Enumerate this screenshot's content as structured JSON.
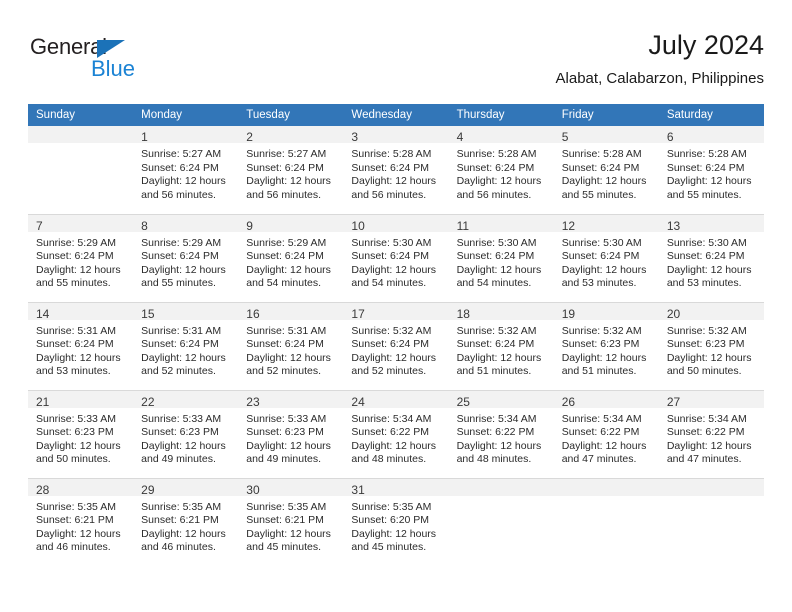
{
  "brand": {
    "name_top": "General",
    "name_bottom": "Blue",
    "triangle_color": "#1b72b8",
    "blue_text_color": "#1b83d4"
  },
  "header": {
    "title": "July 2024",
    "subtitle": "Alabat, Calabarzon, Philippines"
  },
  "theme": {
    "header_bg": "#3276b8",
    "header_text": "#ffffff",
    "daynum_bg": "#f2f2f2",
    "grid_line": "#d9d9d9",
    "body_text": "#2b2b2b"
  },
  "weekday_headers": [
    "Sunday",
    "Monday",
    "Tuesday",
    "Wednesday",
    "Thursday",
    "Friday",
    "Saturday"
  ],
  "weeks": [
    [
      {
        "day": "",
        "blank": true,
        "sunrise": "",
        "sunset": "",
        "daylight_1": "",
        "daylight_2": ""
      },
      {
        "day": "1",
        "sunrise": "Sunrise: 5:27 AM",
        "sunset": "Sunset: 6:24 PM",
        "daylight_1": "Daylight: 12 hours",
        "daylight_2": "and 56 minutes."
      },
      {
        "day": "2",
        "sunrise": "Sunrise: 5:27 AM",
        "sunset": "Sunset: 6:24 PM",
        "daylight_1": "Daylight: 12 hours",
        "daylight_2": "and 56 minutes."
      },
      {
        "day": "3",
        "sunrise": "Sunrise: 5:28 AM",
        "sunset": "Sunset: 6:24 PM",
        "daylight_1": "Daylight: 12 hours",
        "daylight_2": "and 56 minutes."
      },
      {
        "day": "4",
        "sunrise": "Sunrise: 5:28 AM",
        "sunset": "Sunset: 6:24 PM",
        "daylight_1": "Daylight: 12 hours",
        "daylight_2": "and 56 minutes."
      },
      {
        "day": "5",
        "sunrise": "Sunrise: 5:28 AM",
        "sunset": "Sunset: 6:24 PM",
        "daylight_1": "Daylight: 12 hours",
        "daylight_2": "and 55 minutes."
      },
      {
        "day": "6",
        "sunrise": "Sunrise: 5:28 AM",
        "sunset": "Sunset: 6:24 PM",
        "daylight_1": "Daylight: 12 hours",
        "daylight_2": "and 55 minutes."
      }
    ],
    [
      {
        "day": "7",
        "sunrise": "Sunrise: 5:29 AM",
        "sunset": "Sunset: 6:24 PM",
        "daylight_1": "Daylight: 12 hours",
        "daylight_2": "and 55 minutes."
      },
      {
        "day": "8",
        "sunrise": "Sunrise: 5:29 AM",
        "sunset": "Sunset: 6:24 PM",
        "daylight_1": "Daylight: 12 hours",
        "daylight_2": "and 55 minutes."
      },
      {
        "day": "9",
        "sunrise": "Sunrise: 5:29 AM",
        "sunset": "Sunset: 6:24 PM",
        "daylight_1": "Daylight: 12 hours",
        "daylight_2": "and 54 minutes."
      },
      {
        "day": "10",
        "sunrise": "Sunrise: 5:30 AM",
        "sunset": "Sunset: 6:24 PM",
        "daylight_1": "Daylight: 12 hours",
        "daylight_2": "and 54 minutes."
      },
      {
        "day": "11",
        "sunrise": "Sunrise: 5:30 AM",
        "sunset": "Sunset: 6:24 PM",
        "daylight_1": "Daylight: 12 hours",
        "daylight_2": "and 54 minutes."
      },
      {
        "day": "12",
        "sunrise": "Sunrise: 5:30 AM",
        "sunset": "Sunset: 6:24 PM",
        "daylight_1": "Daylight: 12 hours",
        "daylight_2": "and 53 minutes."
      },
      {
        "day": "13",
        "sunrise": "Sunrise: 5:30 AM",
        "sunset": "Sunset: 6:24 PM",
        "daylight_1": "Daylight: 12 hours",
        "daylight_2": "and 53 minutes."
      }
    ],
    [
      {
        "day": "14",
        "sunrise": "Sunrise: 5:31 AM",
        "sunset": "Sunset: 6:24 PM",
        "daylight_1": "Daylight: 12 hours",
        "daylight_2": "and 53 minutes."
      },
      {
        "day": "15",
        "sunrise": "Sunrise: 5:31 AM",
        "sunset": "Sunset: 6:24 PM",
        "daylight_1": "Daylight: 12 hours",
        "daylight_2": "and 52 minutes."
      },
      {
        "day": "16",
        "sunrise": "Sunrise: 5:31 AM",
        "sunset": "Sunset: 6:24 PM",
        "daylight_1": "Daylight: 12 hours",
        "daylight_2": "and 52 minutes."
      },
      {
        "day": "17",
        "sunrise": "Sunrise: 5:32 AM",
        "sunset": "Sunset: 6:24 PM",
        "daylight_1": "Daylight: 12 hours",
        "daylight_2": "and 52 minutes."
      },
      {
        "day": "18",
        "sunrise": "Sunrise: 5:32 AM",
        "sunset": "Sunset: 6:24 PM",
        "daylight_1": "Daylight: 12 hours",
        "daylight_2": "and 51 minutes."
      },
      {
        "day": "19",
        "sunrise": "Sunrise: 5:32 AM",
        "sunset": "Sunset: 6:23 PM",
        "daylight_1": "Daylight: 12 hours",
        "daylight_2": "and 51 minutes."
      },
      {
        "day": "20",
        "sunrise": "Sunrise: 5:32 AM",
        "sunset": "Sunset: 6:23 PM",
        "daylight_1": "Daylight: 12 hours",
        "daylight_2": "and 50 minutes."
      }
    ],
    [
      {
        "day": "21",
        "sunrise": "Sunrise: 5:33 AM",
        "sunset": "Sunset: 6:23 PM",
        "daylight_1": "Daylight: 12 hours",
        "daylight_2": "and 50 minutes."
      },
      {
        "day": "22",
        "sunrise": "Sunrise: 5:33 AM",
        "sunset": "Sunset: 6:23 PM",
        "daylight_1": "Daylight: 12 hours",
        "daylight_2": "and 49 minutes."
      },
      {
        "day": "23",
        "sunrise": "Sunrise: 5:33 AM",
        "sunset": "Sunset: 6:23 PM",
        "daylight_1": "Daylight: 12 hours",
        "daylight_2": "and 49 minutes."
      },
      {
        "day": "24",
        "sunrise": "Sunrise: 5:34 AM",
        "sunset": "Sunset: 6:22 PM",
        "daylight_1": "Daylight: 12 hours",
        "daylight_2": "and 48 minutes."
      },
      {
        "day": "25",
        "sunrise": "Sunrise: 5:34 AM",
        "sunset": "Sunset: 6:22 PM",
        "daylight_1": "Daylight: 12 hours",
        "daylight_2": "and 48 minutes."
      },
      {
        "day": "26",
        "sunrise": "Sunrise: 5:34 AM",
        "sunset": "Sunset: 6:22 PM",
        "daylight_1": "Daylight: 12 hours",
        "daylight_2": "and 47 minutes."
      },
      {
        "day": "27",
        "sunrise": "Sunrise: 5:34 AM",
        "sunset": "Sunset: 6:22 PM",
        "daylight_1": "Daylight: 12 hours",
        "daylight_2": "and 47 minutes."
      }
    ],
    [
      {
        "day": "28",
        "sunrise": "Sunrise: 5:35 AM",
        "sunset": "Sunset: 6:21 PM",
        "daylight_1": "Daylight: 12 hours",
        "daylight_2": "and 46 minutes."
      },
      {
        "day": "29",
        "sunrise": "Sunrise: 5:35 AM",
        "sunset": "Sunset: 6:21 PM",
        "daylight_1": "Daylight: 12 hours",
        "daylight_2": "and 46 minutes."
      },
      {
        "day": "30",
        "sunrise": "Sunrise: 5:35 AM",
        "sunset": "Sunset: 6:21 PM",
        "daylight_1": "Daylight: 12 hours",
        "daylight_2": "and 45 minutes."
      },
      {
        "day": "31",
        "sunrise": "Sunrise: 5:35 AM",
        "sunset": "Sunset: 6:20 PM",
        "daylight_1": "Daylight: 12 hours",
        "daylight_2": "and 45 minutes."
      },
      {
        "day": "",
        "blank": true,
        "sunrise": "",
        "sunset": "",
        "daylight_1": "",
        "daylight_2": ""
      },
      {
        "day": "",
        "blank": true,
        "sunrise": "",
        "sunset": "",
        "daylight_1": "",
        "daylight_2": ""
      },
      {
        "day": "",
        "blank": true,
        "sunrise": "",
        "sunset": "",
        "daylight_1": "",
        "daylight_2": ""
      }
    ]
  ]
}
